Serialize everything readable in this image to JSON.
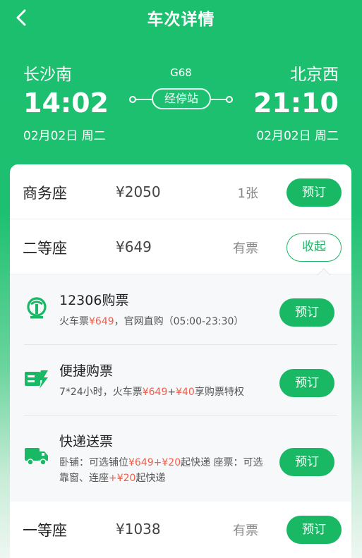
{
  "header": {
    "title": "车次详情"
  },
  "trip": {
    "train_no": "G68",
    "stops_label": "经停站",
    "from": {
      "station": "长沙南",
      "time": "14:02",
      "date": "02月02日 周二"
    },
    "to": {
      "station": "北京西",
      "time": "21:10",
      "date": "02月02日 周二"
    }
  },
  "seats": [
    {
      "name": "商务座",
      "price": "¥2050",
      "availability": "1张",
      "action": "预订"
    },
    {
      "name": "二等座",
      "price": "¥649",
      "availability": "有票",
      "action": "收起"
    },
    {
      "name": "一等座",
      "price": "¥1038",
      "availability": "有票",
      "action": "预订"
    }
  ],
  "options": [
    {
      "icon": "railway-logo-icon",
      "title": "12306购票",
      "desc": [
        "火车票",
        "¥649",
        "，官网直购（05:00-23:30）"
      ],
      "action": "预订"
    },
    {
      "icon": "flash-ticket-icon",
      "title": "便捷购票",
      "desc": [
        "7*24小时，火车票",
        "¥649",
        "+",
        "¥40",
        "享购票特权"
      ],
      "action": "预订"
    },
    {
      "icon": "delivery-truck-icon",
      "title": "快递送票",
      "desc": [
        "卧铺：可选铺位",
        "¥649",
        "+",
        "¥20",
        "起快递 座票：可选靠窗、连座",
        "+¥20",
        "起快递"
      ],
      "action": "预订"
    }
  ],
  "colors": {
    "brand": "#19b864",
    "price_highlight": "#f25c4a"
  }
}
